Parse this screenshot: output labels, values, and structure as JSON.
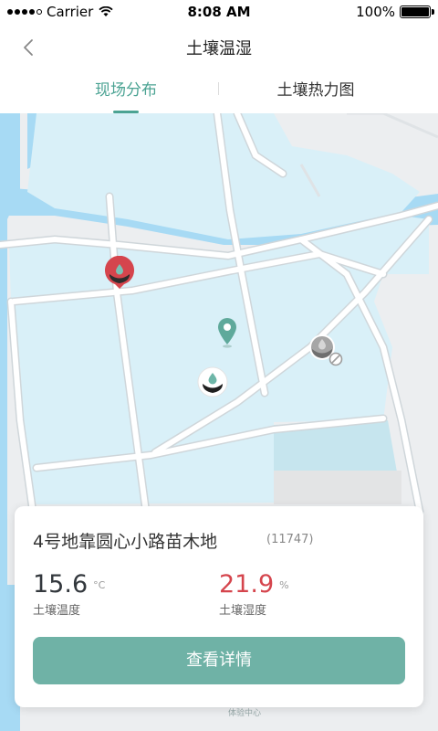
{
  "status_bar": {
    "carrier": "Carrier",
    "time": "8:08 AM",
    "battery": "100%"
  },
  "nav": {
    "title": "土壤温湿"
  },
  "tabs": [
    {
      "label": "现场分布",
      "active": true
    },
    {
      "label": "土壤热力图",
      "active": false
    }
  ],
  "map": {
    "place_label": "体验中心"
  },
  "card": {
    "title": "4号地靠圆心小路苗木地",
    "id": "(11747)",
    "temperature": {
      "value": "15.6",
      "unit": "°C",
      "label": "土壤温度"
    },
    "humidity": {
      "value": "21.9",
      "unit": "%",
      "label": "土壤湿度"
    },
    "button_label": "查看详情"
  },
  "colors": {
    "accent": "#4ba393",
    "button": "#6fb2a6",
    "humidity_value": "#d5454d",
    "pin_alert": "#d5454d",
    "pin_offline": "#9e9e9e"
  }
}
